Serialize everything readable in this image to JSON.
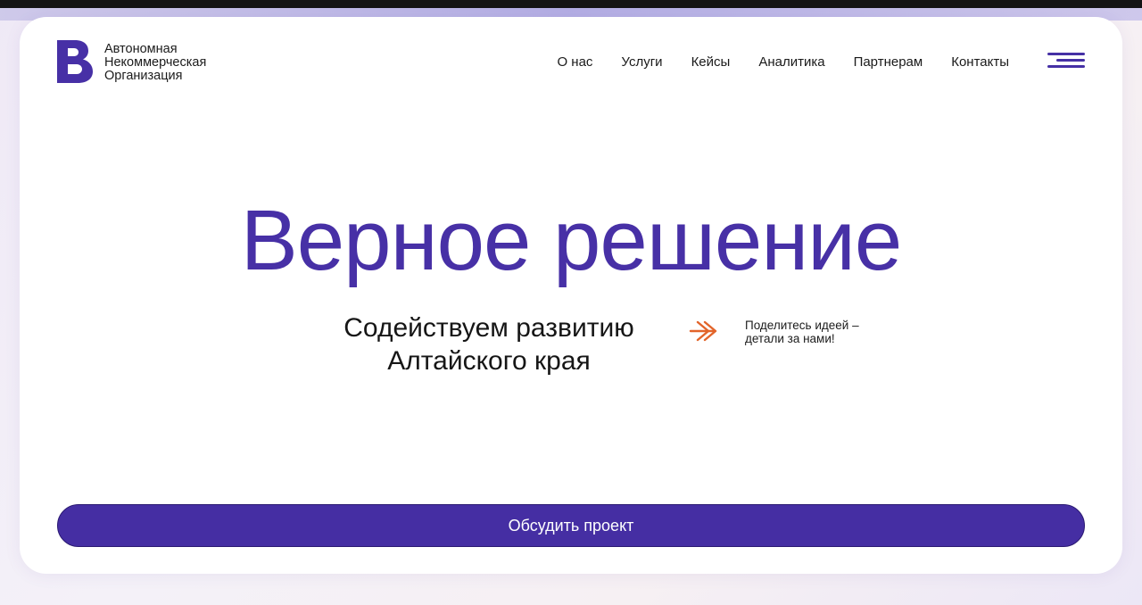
{
  "logo": {
    "lines": [
      "Автономная",
      "Некоммерческая",
      "Организация"
    ],
    "icon": "logo-b-icon",
    "color": "#4730a6"
  },
  "nav": {
    "items": [
      "О нас",
      "Услуги",
      "Кейсы",
      "Аналитика",
      "Партнерам",
      "Контакты"
    ],
    "menu_icon": "hamburger-menu-icon"
  },
  "hero": {
    "title": "Верное решение",
    "subtitle_lines": [
      "Содействуем развитию",
      "Алтайского края"
    ],
    "arrow_icon": "double-chevron-right-icon",
    "note_lines": [
      "Поделитесь идеей –",
      "детали за нами!"
    ]
  },
  "cta": {
    "label": "Обсудить проект"
  },
  "colors": {
    "brand": "#4730a6",
    "accent_arrow": "#e2642a",
    "text": "#1a1a1a"
  }
}
